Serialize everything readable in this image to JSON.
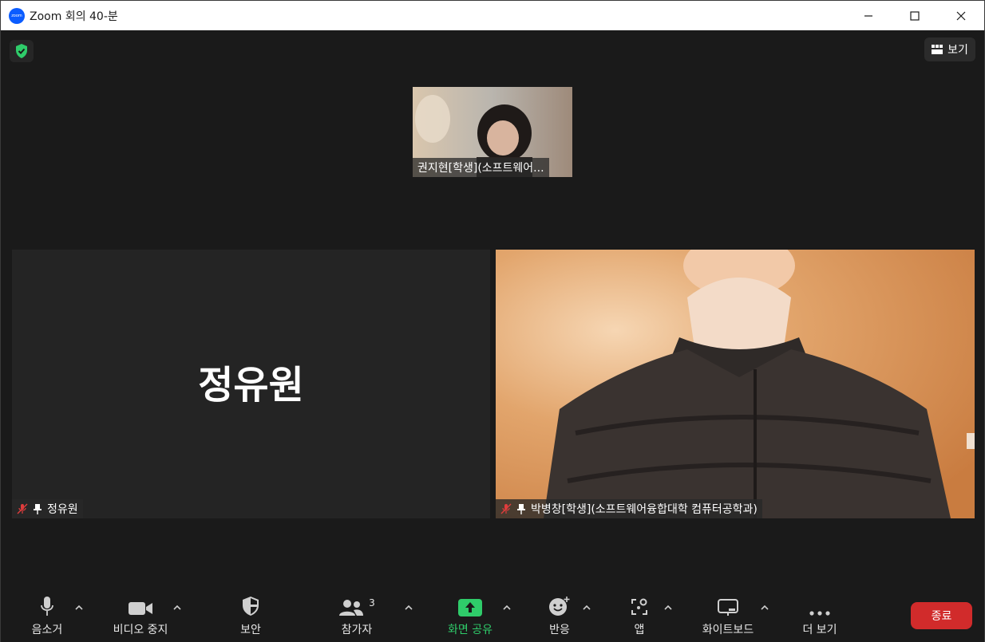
{
  "window": {
    "title": "Zoom 회의 40-분",
    "app_logo_text": "zoom",
    "minimize_icon": "minimize-icon",
    "maximize_icon": "maximize-icon",
    "close_icon": "close-icon"
  },
  "header": {
    "security_icon": "shield-check-icon",
    "view_label": "보기",
    "view_icon": "grid-icon"
  },
  "participants": {
    "thumbnail_name": "권지현[학생](소프트웨어...",
    "left_tile": {
      "big_name": "정유원",
      "name_tag": "정유원",
      "muted": true,
      "pinned": true
    },
    "right_tile": {
      "name_tag": "박병창[학생](소프트웨어융합대학 컴퓨터공학과)",
      "muted": true,
      "pinned": true
    }
  },
  "toolbar": {
    "mute_label": "음소거",
    "video_label": "비디오 중지",
    "security_label": "보안",
    "participants_label": "참가자",
    "participants_count": "3",
    "share_label": "화면 공유",
    "reactions_label": "반응",
    "apps_label": "앱",
    "whiteboard_label": "화이트보드",
    "more_label": "더 보기",
    "end_label": "종료"
  },
  "colors": {
    "accent_green": "#2fcc6a",
    "end_red": "#d12b2b",
    "zoom_blue": "#0b5cff",
    "muted_red": "#e03c3c"
  }
}
